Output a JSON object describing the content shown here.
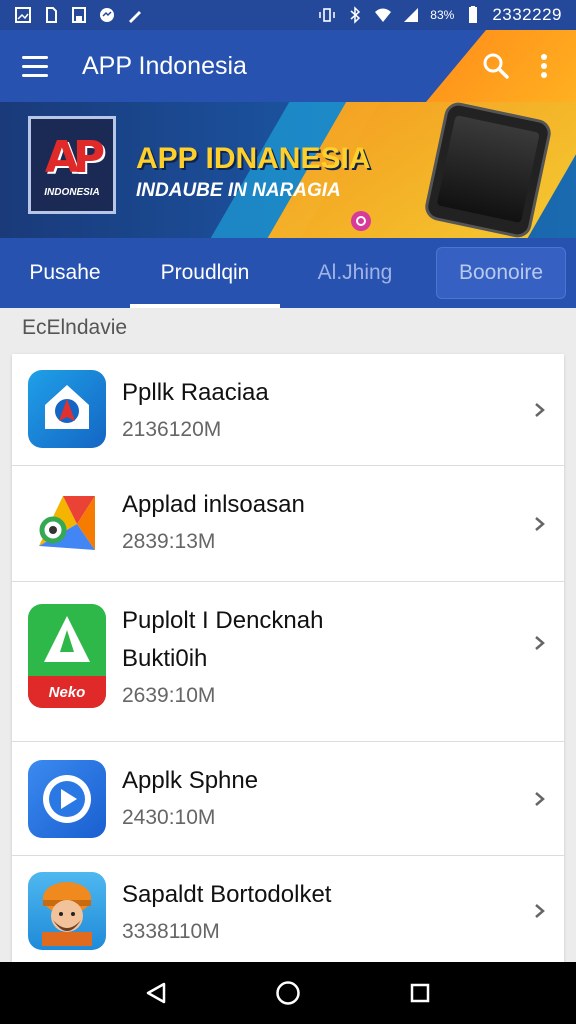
{
  "status_bar": {
    "left_icons": [
      "image-icon",
      "sim-icon",
      "save-icon",
      "messenger-icon",
      "signal-pen-icon"
    ],
    "battery_percent": "83%",
    "clock": "2332229"
  },
  "app_bar": {
    "title": "APP Indonesia"
  },
  "banner": {
    "headline": "APP IDNANESIA",
    "subline": "INDAUBE IN NARAGIA",
    "logo_text": "INDONESIA",
    "logo_mark": "AP"
  },
  "tabs": [
    {
      "label": "Pusahe"
    },
    {
      "label": "Proudlqin"
    },
    {
      "label": "Al.Jhing"
    },
    {
      "label": "Boonoire"
    }
  ],
  "section": {
    "title": "EcElndavie"
  },
  "apps": [
    {
      "name_line1": "Ppllk Raaciaa",
      "name_line2": "",
      "size": "2136120M"
    },
    {
      "name_line1": "Applad inlsoasan",
      "name_line2": "",
      "size": "2839:13M"
    },
    {
      "name_line1": "Puplolt I Dencknah",
      "name_line2": "Bukti0ih",
      "size": "2639:10M",
      "icon_label": "Neko"
    },
    {
      "name_line1": "Applk Sphne",
      "name_line2": "",
      "size": "2430:10M"
    },
    {
      "name_line1": "Sapaldt Bortodolket",
      "name_line2": "",
      "size": "3338110M"
    }
  ],
  "colors": {
    "primary": "#2852b0",
    "accent": "#ffa21a",
    "status_bar": "#24489a"
  }
}
